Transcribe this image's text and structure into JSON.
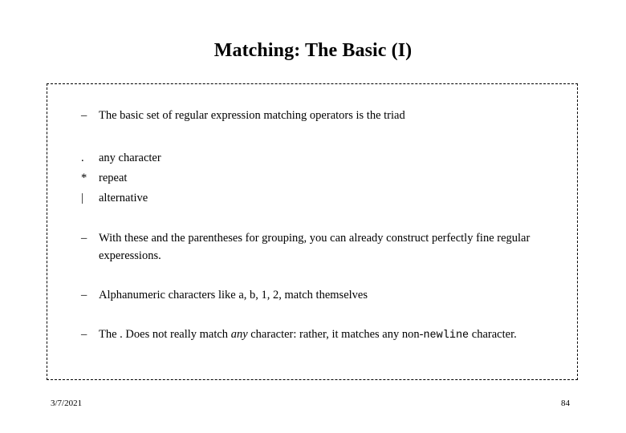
{
  "slide": {
    "title": "Matching: The Basic (I)",
    "bullet_marker": "–",
    "intro_bullet": "The basic set of regular expression matching operators is the triad",
    "operators": [
      {
        "symbol": ".",
        "description": "any character"
      },
      {
        "symbol": "*",
        "description": "repeat"
      },
      {
        "symbol": "|",
        "description": "alternative"
      }
    ],
    "bullets": [
      "With these and the parentheses for grouping, you can already construct perfectly fine regular experessions.",
      "Alphanumeric characters like a, b, 1, 2, match themselves"
    ],
    "final_bullet": {
      "part1": "The . Does not really match ",
      "emphasis": "any",
      "part2": " character: rather, it matches any non-",
      "mono": "newline",
      "part3": " character."
    }
  },
  "footer": {
    "date": "3/7/2021",
    "page_number": "84"
  }
}
